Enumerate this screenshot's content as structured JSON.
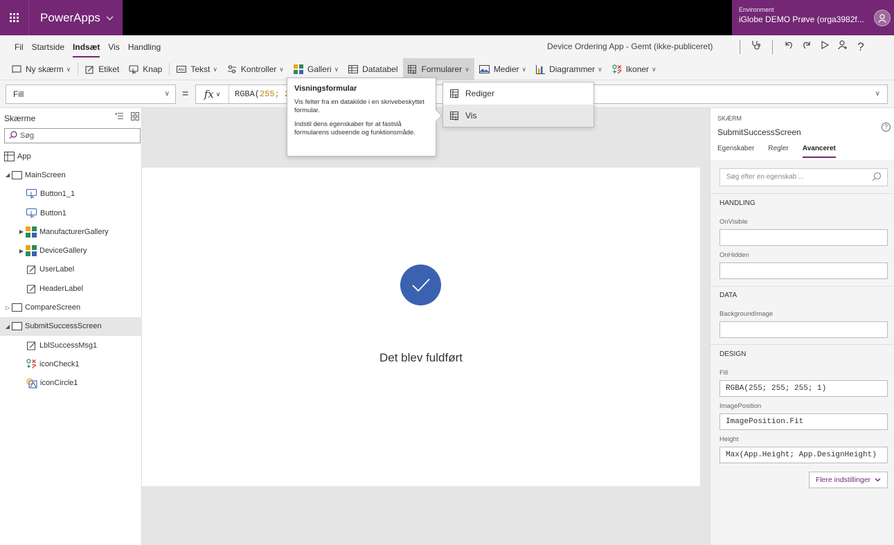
{
  "topbar": {
    "app_name": "PowerApps",
    "env_label": "Environment",
    "env_value": "iGlobe DEMO Prøve (orga3982f..."
  },
  "menu": {
    "items": [
      "Fil",
      "Startside",
      "Indsæt",
      "Vis",
      "Handling"
    ],
    "active": "Indsæt",
    "doc_title": "Device Ordering App - Gemt (ikke-publiceret)"
  },
  "ribbon": {
    "new_screen": "Ny skærm",
    "label": "Etiket",
    "button": "Knap",
    "text": "Tekst",
    "controls": "Kontroller",
    "gallery": "Galleri",
    "datatable": "Datatabel",
    "forms": "Formularer",
    "media": "Medier",
    "charts": "Diagrammer",
    "icons": "Ikoner"
  },
  "formula": {
    "property": "Fill",
    "eq": "=",
    "fx": "fx",
    "text_prefix": "RGBA(",
    "text_num": "255;",
    "text_rest": " 2"
  },
  "tree": {
    "title": "Skærme",
    "search_placeholder": "Søg",
    "items": [
      {
        "label": "App",
        "level": 0,
        "icon": "app"
      },
      {
        "label": "MainScreen",
        "level": 0,
        "icon": "screen",
        "expanded": true
      },
      {
        "label": "Button1_1",
        "level": 1,
        "icon": "button"
      },
      {
        "label": "Button1",
        "level": 1,
        "icon": "button"
      },
      {
        "label": "ManufacturerGallery",
        "level": 1,
        "icon": "gallery",
        "collapsed": true
      },
      {
        "label": "DeviceGallery",
        "level": 1,
        "icon": "gallery",
        "collapsed": true
      },
      {
        "label": "UserLabel",
        "level": 1,
        "icon": "label"
      },
      {
        "label": "HeaderLabel",
        "level": 1,
        "icon": "label"
      },
      {
        "label": "CompareScreen",
        "level": 0,
        "icon": "screen",
        "collapsed": true
      },
      {
        "label": "SubmitSuccessScreen",
        "level": 0,
        "icon": "screen",
        "expanded": true,
        "selected": true
      },
      {
        "label": "LblSuccessMsg1",
        "level": 1,
        "icon": "label"
      },
      {
        "label": "iconCheck1",
        "level": 1,
        "icon": "icons"
      },
      {
        "label": "iconCircle1",
        "level": 1,
        "icon": "shape"
      }
    ]
  },
  "canvas": {
    "message": "Det blev fuldført"
  },
  "tooltip": {
    "title": "Visningsformular",
    "p1": "Vis felter fra en datakilde i en skrivebeskyttet formular.",
    "p2": "Indstil dens egenskaber for at fastslå formularens udseende og funktionsmåde."
  },
  "dropdown": {
    "items": [
      "Rediger",
      "Vis"
    ]
  },
  "rightpanel": {
    "section_label": "SKÆRM",
    "screen_name": "SubmitSuccessScreen",
    "tabs": [
      "Egenskaber",
      "Regler",
      "Avanceret"
    ],
    "active_tab": "Avanceret",
    "search_placeholder": "Søg efter en egenskab ...",
    "handling_title": "HANDLING",
    "onvisible_label": "OnVisible",
    "onvisible_value": "",
    "onhidden_label": "OnHidden",
    "onhidden_value": "",
    "data_title": "DATA",
    "bgimage_label": "BackgroundImage",
    "bgimage_value": "",
    "design_title": "DESIGN",
    "fill_label": "Fill",
    "fill_value": "RGBA(255; 255; 255; 1)",
    "imgpos_label": "ImagePosition",
    "imgpos_value": "ImagePosition.Fit",
    "height_label": "Height",
    "height_value": "Max(App.Height; App.DesignHeight)",
    "more_button": "Flere indstillinger"
  },
  "colors": {
    "brand": "#742774",
    "check_circle": "#3a62b0"
  }
}
